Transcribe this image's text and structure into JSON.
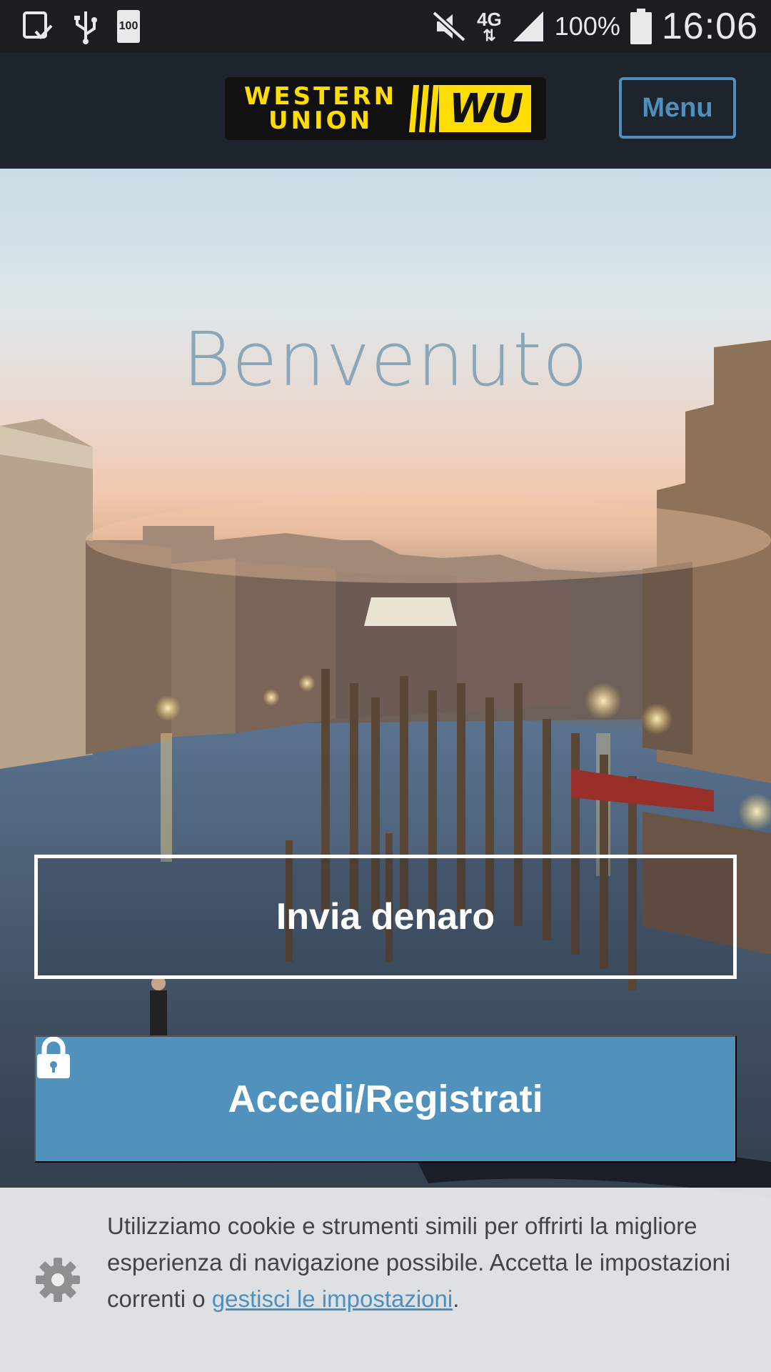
{
  "status_bar": {
    "network_type": "4G",
    "battery_percent": "100%",
    "battery_icon_label": "100",
    "time": "16:06",
    "icons": [
      "download-done-icon",
      "usb-icon",
      "battery-full-small-icon",
      "mute-icon",
      "network-arrows-icon",
      "signal-icon",
      "battery-icon"
    ]
  },
  "header": {
    "logo_line1": "WESTERN",
    "logo_line2": "UNION",
    "logo_mark": "WU",
    "menu_label": "Menu"
  },
  "hero": {
    "title": "Benvenuto",
    "send_money_label": "Invia denaro",
    "login_label": "Accedi/Registrati"
  },
  "cookie_banner": {
    "text": "Utilizziamo cookie e strumenti simili per offrirti la migliore esperienza di navigazione possibile. Accetta le impostazioni correnti o ",
    "link_text": "gestisci le impostazioni",
    "trailing": "."
  },
  "colors": {
    "accent_blue": "#5192bd",
    "header_bg": "#1e242c",
    "logo_yellow": "#ffdd00"
  }
}
